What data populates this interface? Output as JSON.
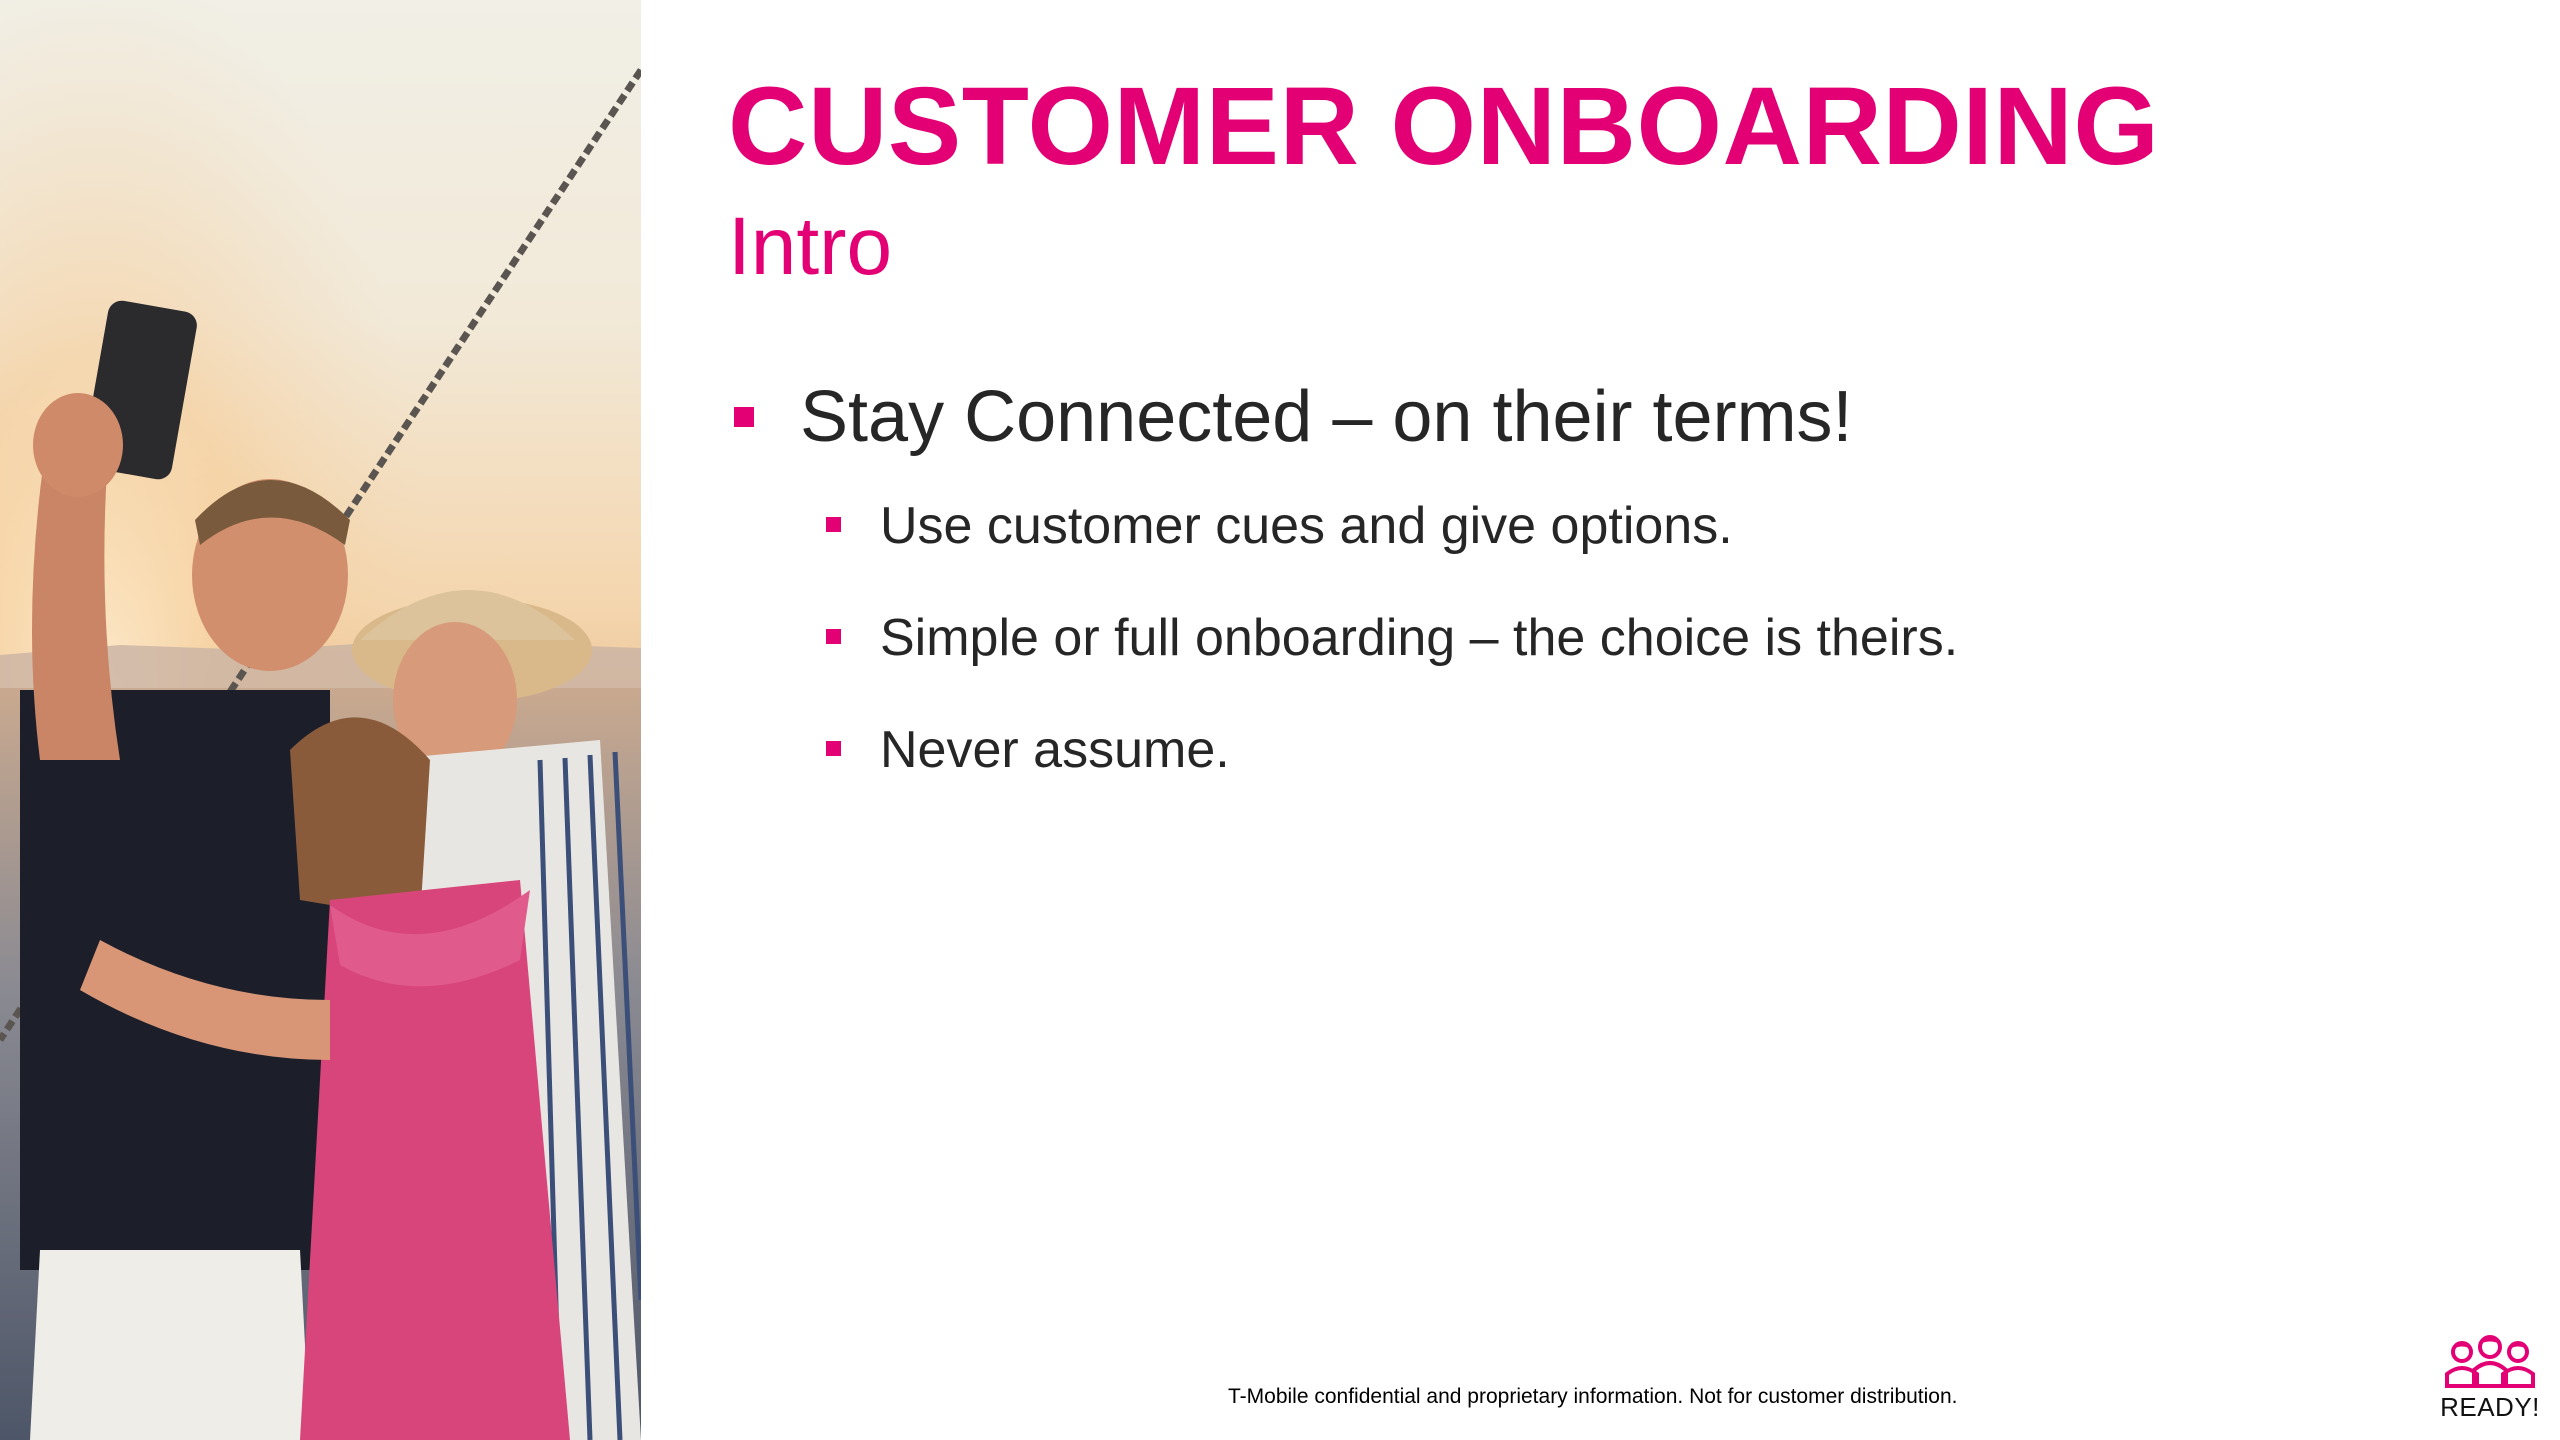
{
  "slide": {
    "title": "CUSTOMER ONBOARDING",
    "subtitle": "Intro",
    "bullets": {
      "main": "Stay Connected – on their terms!",
      "sub": [
        "Use customer cues and give options.",
        "Simple or full onboarding – the choice is theirs.",
        "Never assume."
      ]
    },
    "footer": "T-Mobile confidential and proprietary information. Not for customer distribution.",
    "logo_text": "READY!"
  },
  "photo": {
    "icon": "family-selfie-photo"
  },
  "colors": {
    "accent": "#e20074",
    "body_text": "#262626",
    "background": "#ffffff"
  }
}
